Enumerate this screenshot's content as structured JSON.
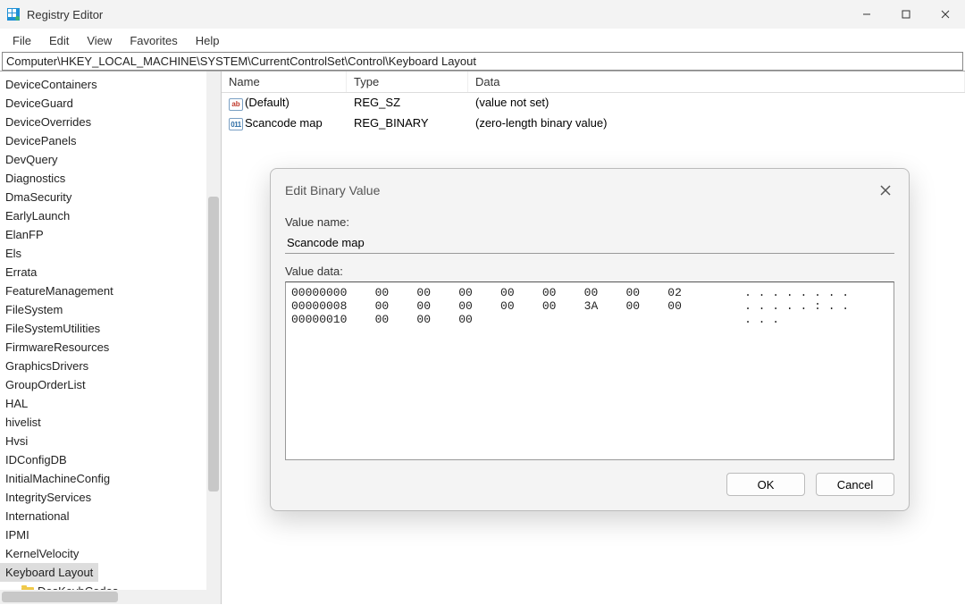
{
  "window": {
    "title": "Registry Editor"
  },
  "menu": {
    "file": "File",
    "edit": "Edit",
    "view": "View",
    "favorites": "Favorites",
    "help": "Help"
  },
  "address": "Computer\\HKEY_LOCAL_MACHINE\\SYSTEM\\CurrentControlSet\\Control\\Keyboard Layout",
  "tree": {
    "items": [
      "DeviceContainers",
      "DeviceGuard",
      "DeviceOverrides",
      "DevicePanels",
      "DevQuery",
      "Diagnostics",
      "DmaSecurity",
      "EarlyLaunch",
      "ElanFP",
      "Els",
      "Errata",
      "FeatureManagement",
      "FileSystem",
      "FileSystemUtilities",
      "FirmwareResources",
      "GraphicsDrivers",
      "GroupOrderList",
      "HAL",
      "hivelist",
      "Hvsi",
      "IDConfigDB",
      "InitialMachineConfig",
      "IntegrityServices",
      "International",
      "IPMI",
      "KernelVelocity",
      "Keyboard Layout"
    ],
    "child": "DosKeybCodes",
    "selected_index": 26
  },
  "list": {
    "headers": {
      "name": "Name",
      "type": "Type",
      "data": "Data"
    },
    "rows": [
      {
        "icon": "ab",
        "name": "(Default)",
        "type": "REG_SZ",
        "data": "(value not set)"
      },
      {
        "icon": "bin",
        "name": "Scancode map",
        "type": "REG_BINARY",
        "data": "(zero-length binary value)"
      }
    ]
  },
  "dialog": {
    "title": "Edit Binary Value",
    "value_name_label": "Value name:",
    "value_name": "Scancode map",
    "value_data_label": "Value data:",
    "hex_lines": [
      "00000000    00    00    00    00    00    00    00    02         . . . . . . . .",
      "00000008    00    00    00    00    00    3A    00    00         . . . . . : . .",
      "00000010    00    00    00                                       . . ."
    ],
    "ok": "OK",
    "cancel": "Cancel"
  }
}
